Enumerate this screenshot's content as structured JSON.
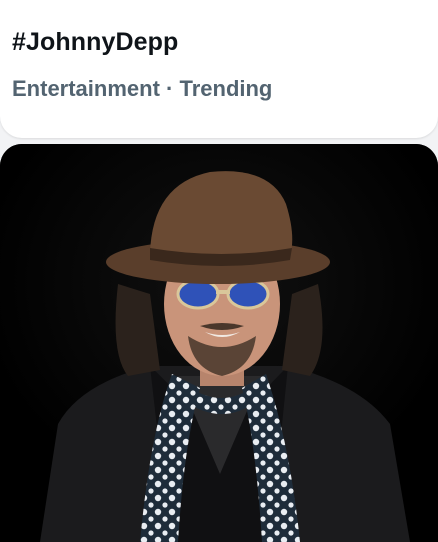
{
  "trend": {
    "hashtag": "#JohnnyDepp",
    "category": "Entertainment",
    "separator": " · ",
    "status": "Trending"
  },
  "colors": {
    "title": "#0f1419",
    "meta": "#536471",
    "photo_background": "#000000"
  }
}
